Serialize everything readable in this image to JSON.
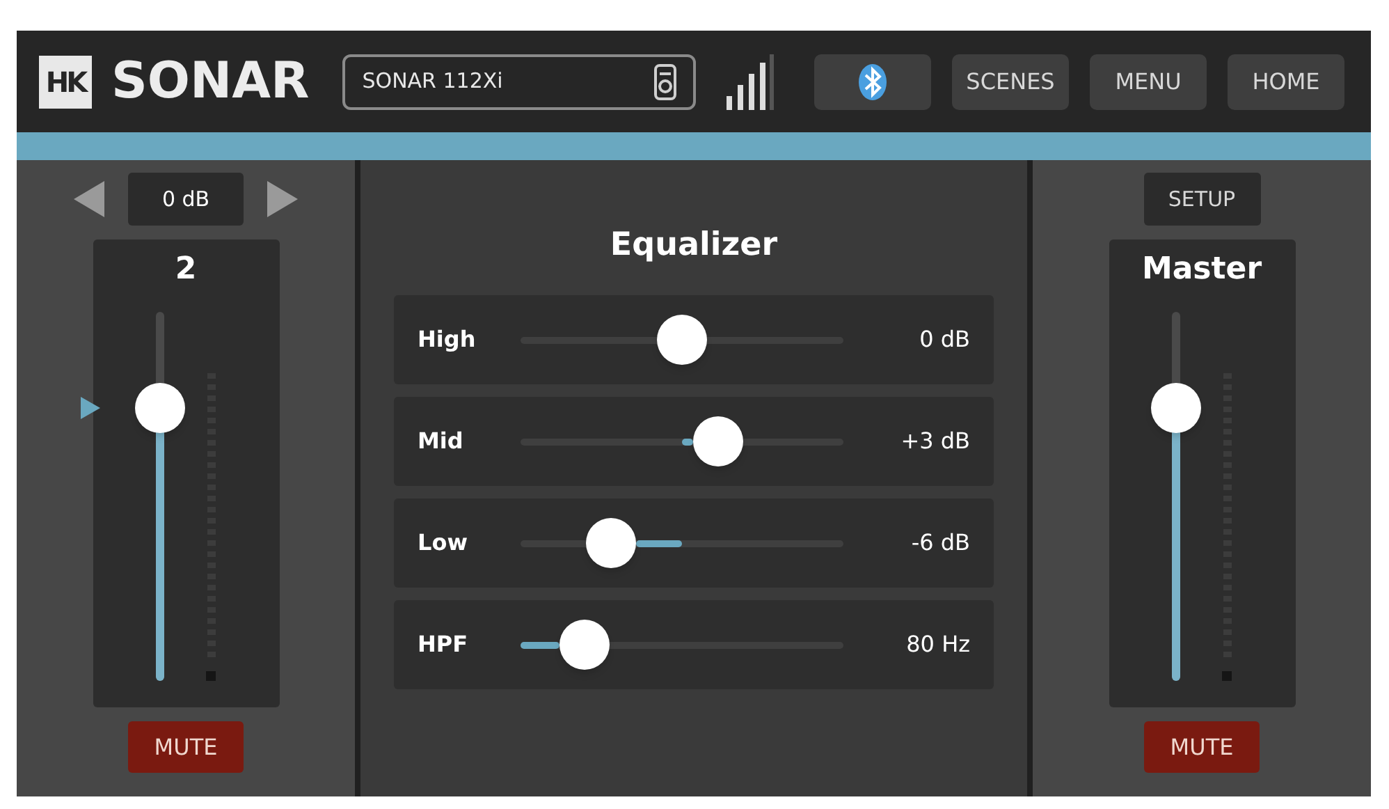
{
  "header": {
    "logo": "HK",
    "brand": "SONAR",
    "device": "SONAR 112Xi",
    "buttons": [
      {
        "kind": "bluetooth"
      },
      {
        "kind": "text",
        "label": "SCENES"
      },
      {
        "kind": "text",
        "label": "MENU"
      },
      {
        "kind": "text",
        "label": "HOME"
      }
    ]
  },
  "channel": {
    "gain": "0 dB",
    "name": "2",
    "level": 0.74,
    "mute": "MUTE"
  },
  "equalizer": {
    "title": "Equalizer",
    "bands": [
      {
        "label": "High",
        "kind": "bipolar",
        "level": 0.5,
        "reading": "0 dB"
      },
      {
        "label": "Mid",
        "kind": "bipolar",
        "level": 0.61,
        "reading": "+3 dB"
      },
      {
        "label": "Low",
        "kind": "bipolar",
        "level": 0.28,
        "reading": "-6 dB"
      },
      {
        "label": "HPF",
        "kind": "unipolar",
        "level": 0.2,
        "reading": "80 Hz"
      }
    ]
  },
  "master": {
    "setup": "SETUP",
    "name": "Master",
    "level": 0.74,
    "mute": "MUTE"
  }
}
